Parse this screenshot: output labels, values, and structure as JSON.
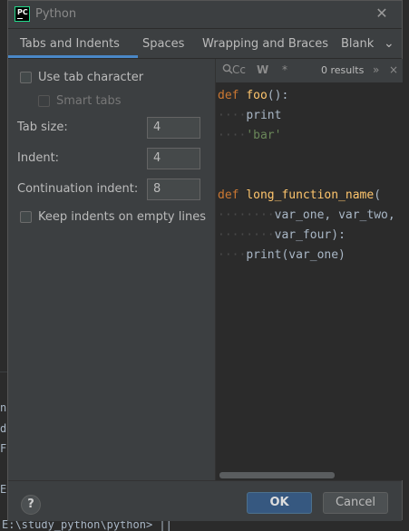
{
  "window": {
    "title": "Python"
  },
  "tabs": [
    {
      "label": "Tabs and Indents",
      "active": true
    },
    {
      "label": "Spaces"
    },
    {
      "label": "Wrapping and Braces"
    },
    {
      "label": "Blank"
    }
  ],
  "options": {
    "use_tab_character": {
      "label": "Use tab character",
      "checked": false
    },
    "smart_tabs": {
      "label": "Smart tabs",
      "checked": false,
      "enabled": false
    },
    "tab_size": {
      "label": "Tab size:",
      "value": "4"
    },
    "indent": {
      "label": "Indent:",
      "value": "4"
    },
    "continuation_indent": {
      "label": "Continuation indent:",
      "value": "8"
    },
    "keep_indents": {
      "label": "Keep indents on empty lines",
      "checked": false
    }
  },
  "preview_search": {
    "match_case": "Cc",
    "words": "W",
    "regex": "*",
    "results": "0 results",
    "more": "»",
    "close": "×"
  },
  "code_preview": {
    "lines": [
      {
        "indent": "····",
        "tokens": [
          [
            "kw",
            "def "
          ],
          [
            "fn",
            "foo"
          ],
          [
            "",
            "():"
          ]
        ],
        "first": true
      },
      {
        "indent": "····",
        "tokens": [
          [
            "",
            "print"
          ]
        ]
      },
      {
        "indent": "····",
        "tokens": [
          [
            "str",
            "'bar'"
          ]
        ]
      },
      {
        "indent": "",
        "tokens": []
      },
      {
        "indent": "",
        "tokens": []
      },
      {
        "indent": "",
        "tokens": [
          [
            "kw",
            "def "
          ],
          [
            "fn",
            "long_function_name"
          ],
          [
            "",
            "("
          ]
        ]
      },
      {
        "indent": "········",
        "tokens": [
          [
            "",
            "var_one, var_two,"
          ]
        ]
      },
      {
        "indent": "········",
        "tokens": [
          [
            "",
            "var_four):"
          ]
        ]
      },
      {
        "indent": "····",
        "tokens": [
          [
            "",
            "print(var_one)"
          ]
        ]
      }
    ]
  },
  "footer": {
    "help": "?",
    "ok": "OK",
    "cancel": "Cancel"
  },
  "background": {
    "terminal_line": "E:\\study_python\\python> ||",
    "left_chars": [
      "ni",
      "do",
      "F",
      "E"
    ]
  },
  "colors": {
    "dialog_bg": "#3c3f41",
    "editor_bg": "#2b2b2b",
    "accent": "#4a88c7",
    "ok_button": "#365880",
    "keyword": "#cc7832",
    "function": "#ffc66d",
    "string": "#6a8759"
  }
}
